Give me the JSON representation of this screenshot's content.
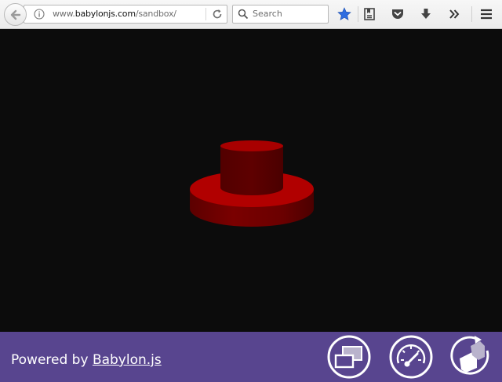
{
  "browser": {
    "url_prefix": "www.",
    "url_host": "babylonjs.com",
    "url_path": "/sandbox/",
    "search_placeholder": "Search",
    "bookmark_color": "#2e6de0"
  },
  "scene": {
    "background": "#0c0c0c",
    "object_color": "#8b0000"
  },
  "footer": {
    "powered_prefix": "Powered by ",
    "powered_link": "Babylon.js",
    "background": "#58458f"
  }
}
